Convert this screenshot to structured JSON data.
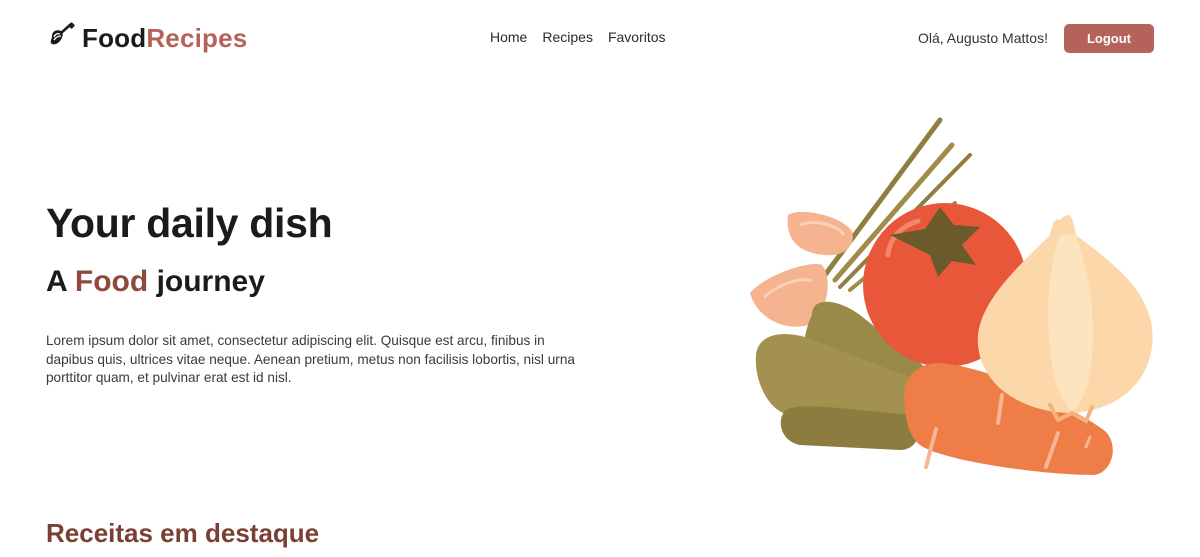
{
  "brand": {
    "name_part1": "Food",
    "name_part2": "Recipes",
    "icon": "whisk-icon",
    "accent_color": "#b5635a"
  },
  "nav": {
    "items": [
      {
        "label": "Home"
      },
      {
        "label": "Recipes"
      },
      {
        "label": "Favoritos"
      }
    ]
  },
  "user": {
    "greeting": "Olá, Augusto Mattos!",
    "logout_label": "Logout"
  },
  "hero": {
    "title": "Your daily dish",
    "subtitle_prefix": "A",
    "subtitle_accent": "Food",
    "subtitle_suffix": "journey",
    "description": "Lorem ipsum dolor sit amet, consectetur adipiscing elit. Quisque est arcu, finibus in dapibus quis, ultrices vitae neque. Aenean pretium, metus non facilisis lobortis, nisl urna porttitor quam, et pulvinar erat est id nisl.",
    "illustration": "vegetables-illustration"
  },
  "featured": {
    "title": "Receitas em destaque"
  }
}
